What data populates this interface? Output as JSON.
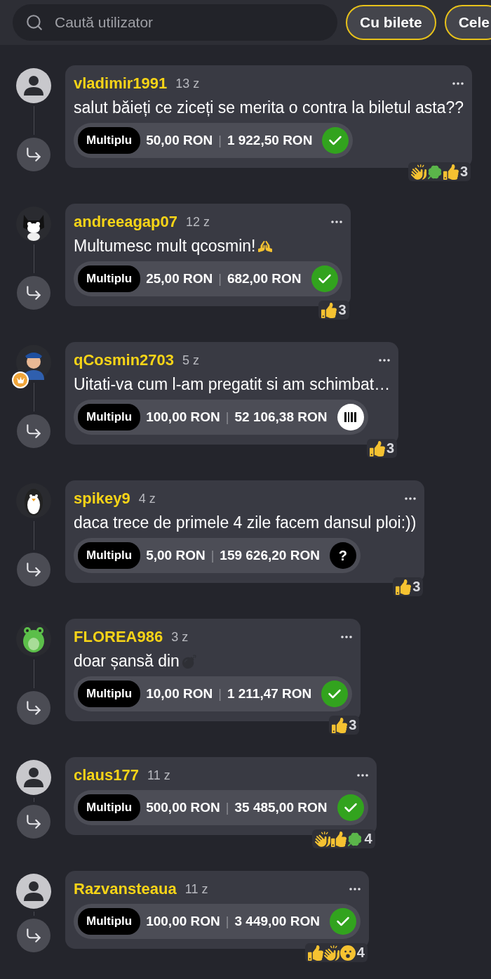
{
  "search": {
    "placeholder": "Caută utilizator"
  },
  "filters": [
    {
      "label": "Cu bilete"
    },
    {
      "label": "Cele"
    }
  ],
  "comments": [
    {
      "user": "vladimir1991",
      "avatar": {
        "kind": "default"
      },
      "badge": false,
      "time": "13 z",
      "message": "salut băieți ce ziceți se merita o contra la biletul asta??",
      "ticket": {
        "type": "Multiplu",
        "stake": "50,00 RON",
        "separator": "|",
        "payout": "1 922,50 RON",
        "status": {
          "kind": "won"
        }
      },
      "reactions": [
        {
          "kind": "clap"
        },
        {
          "kind": "clover"
        },
        {
          "kind": "thumbs"
        }
      ],
      "reaction_count": "3"
    },
    {
      "user": "andreeagap07",
      "avatar": {
        "kind": "cat"
      },
      "badge": false,
      "time": "12 z",
      "message": "Multumesc mult qcosmin!",
      "emoji": {
        "kind": "pray"
      },
      "ticket": {
        "type": "Multiplu",
        "stake": "25,00 RON",
        "separator": "|",
        "payout": "682,00 RON",
        "status": {
          "kind": "won"
        }
      },
      "reactions": [
        {
          "kind": "thumbs"
        }
      ],
      "reaction_count": "3"
    },
    {
      "user": "qCosmin2703",
      "avatar": {
        "kind": "officer"
      },
      "badge": true,
      "time": "5 z",
      "message": "Uitati-va cum l-am pregatit si am schimbat…",
      "ticket": {
        "type": "Multiplu",
        "stake": "100,00 RON",
        "separator": "|",
        "payout": "52 106,38 RON",
        "status": {
          "kind": "pending"
        }
      },
      "reactions": [
        {
          "kind": "thumbs"
        }
      ],
      "reaction_count": "3"
    },
    {
      "user": "spikey9",
      "avatar": {
        "kind": "penguin"
      },
      "badge": false,
      "time": "4 z",
      "message": "daca trece de primele 4 zile facem dansul ploi:))",
      "ticket": {
        "type": "Multiplu",
        "stake": "5,00 RON",
        "separator": "|",
        "payout": "159 626,20 RON",
        "status": {
          "kind": "unknown",
          "text": "?"
        }
      },
      "reactions": [
        {
          "kind": "thumbs"
        }
      ],
      "reaction_count": "3"
    },
    {
      "user": "FLOREA986",
      "avatar": {
        "kind": "frog"
      },
      "badge": false,
      "time": "3 z",
      "message": "doar șansă din",
      "emoji": {
        "kind": "bomb"
      },
      "ticket": {
        "type": "Multiplu",
        "stake": "10,00 RON",
        "separator": "|",
        "payout": "1 211,47 RON",
        "status": {
          "kind": "won"
        }
      },
      "reactions": [
        {
          "kind": "thumbs"
        }
      ],
      "reaction_count": "3"
    },
    {
      "user": "claus177",
      "avatar": {
        "kind": "default"
      },
      "badge": false,
      "time": "11 z",
      "ticket": {
        "type": "Multiplu",
        "stake": "500,00 RON",
        "separator": "|",
        "payout": "35 485,00 RON",
        "status": {
          "kind": "won"
        }
      },
      "reactions": [
        {
          "kind": "clap"
        },
        {
          "kind": "thumbs"
        },
        {
          "kind": "clover"
        }
      ],
      "reaction_count": "4"
    },
    {
      "user": "Razvansteaua",
      "avatar": {
        "kind": "default"
      },
      "badge": false,
      "time": "11 z",
      "ticket": {
        "type": "Multiplu",
        "stake": "100,00 RON",
        "separator": "|",
        "payout": "3 449,00 RON",
        "status": {
          "kind": "won"
        }
      },
      "reactions": [
        {
          "kind": "thumbs"
        },
        {
          "kind": "clap"
        },
        {
          "kind": "surprised"
        }
      ],
      "reaction_count": "4"
    }
  ]
}
